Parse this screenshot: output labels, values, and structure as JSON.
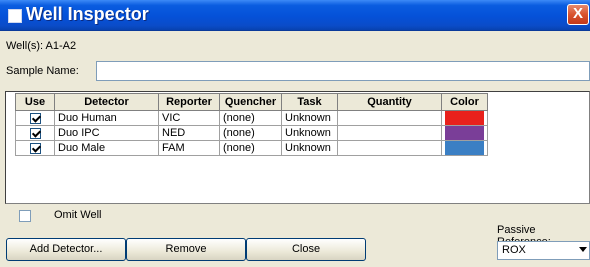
{
  "window": {
    "title": "Well Inspector",
    "close_glyph": "X"
  },
  "wells": {
    "label": "Well(s): A1-A2"
  },
  "sample": {
    "label": "Sample Name:",
    "value": ""
  },
  "table": {
    "headers": [
      "Use",
      "Detector",
      "Reporter",
      "Quencher",
      "Task",
      "Quantity",
      "Color"
    ],
    "rows": [
      {
        "use": true,
        "detector": "Duo Human",
        "reporter": "VIC",
        "quencher": "(none)",
        "task": "Unknown",
        "quantity": "",
        "color": "#e8211c"
      },
      {
        "use": true,
        "detector": "Duo IPC",
        "reporter": "NED",
        "quencher": "(none)",
        "task": "Unknown",
        "quantity": "",
        "color": "#7a3e98"
      },
      {
        "use": true,
        "detector": "Duo Male",
        "reporter": "FAM",
        "quencher": "(none)",
        "task": "Unknown",
        "quantity": "",
        "color": "#3b7fc4"
      }
    ]
  },
  "omit": {
    "label": "Omit Well",
    "checked": false
  },
  "buttons": {
    "add_detector": "Add Detector...",
    "remove": "Remove",
    "close": "Close"
  },
  "passive": {
    "label": "Passive Reference:",
    "value": "ROX"
  },
  "icons": {
    "window_icon": "window-icon",
    "close": "close-icon",
    "dropdown": "chevron-down-icon",
    "checkbox": "checkmark-icon"
  }
}
